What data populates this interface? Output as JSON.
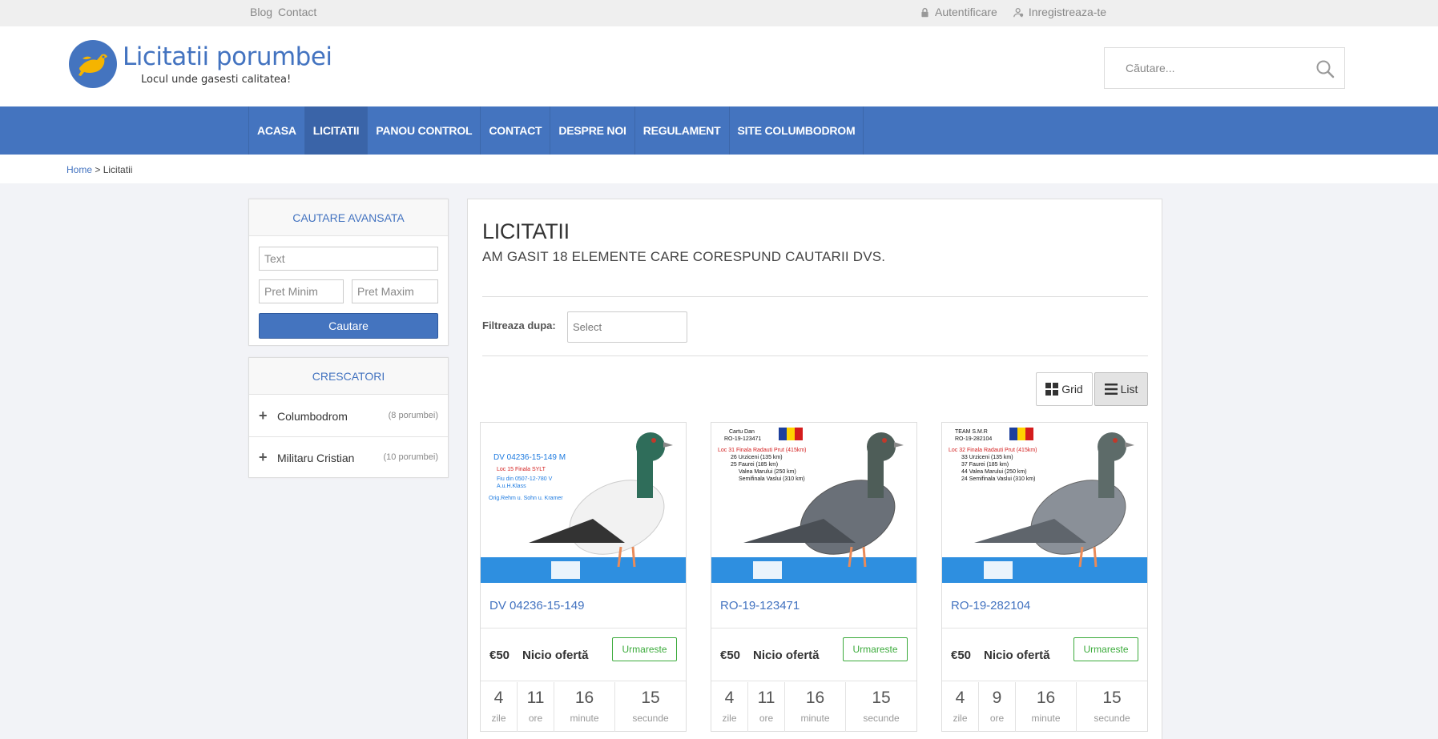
{
  "topbar": {
    "blog": "Blog",
    "contact": "Contact",
    "login": "Autentificare",
    "register": "Inregistreaza-te"
  },
  "header": {
    "brand": "Licitatii porumbei",
    "tagline": "Locul unde gasesti calitatea!",
    "search_placeholder": "Căutare..."
  },
  "nav": [
    "ACASA",
    "LICITATII",
    "PANOU CONTROL",
    "CONTACT",
    "DESPRE NOI",
    "REGULAMENT",
    "SITE COLUMBODROM"
  ],
  "nav_active": "LICITATII",
  "breadcrumb": {
    "home": "Home",
    "sep": ">",
    "current": "Licitatii"
  },
  "advanced_search": {
    "title": "CAUTARE AVANSATA",
    "text_placeholder": "Text",
    "min_placeholder": "Pret Minim",
    "max_placeholder": "Pret Maxim",
    "button": "Cautare"
  },
  "breeders": {
    "title": "CRESCATORI",
    "items": [
      {
        "name": "Columbodrom",
        "count": "(8 porumbei)"
      },
      {
        "name": "Militaru Cristian",
        "count": "(10 porumbei)"
      }
    ]
  },
  "main": {
    "title": "LICITATII",
    "subtitle": "AM GASIT 18 ELEMENTE CARE CORESPUND CAUTARII DVS.",
    "filter_label": "Filtreaza dupa:",
    "filter_select": "Select",
    "view_grid": "Grid",
    "view_list": "List"
  },
  "countdown_units": [
    "zile",
    "ore",
    "minute",
    "secunde"
  ],
  "cards": [
    {
      "title": "DV 04236-15-149",
      "price": "€50",
      "offer": "Nicio ofertă",
      "follow": "Urmareste",
      "countdown": [
        "4",
        "11",
        "16",
        "15"
      ],
      "image_text": {
        "l1": "DV 04236-15-149  M",
        "l2": "Loc 15 Finala SYLT",
        "l3": "Fiu din 0507-12-780 V",
        "l4": "A.u.H.Klass",
        "l5": "Orig.Rehm u. Sohn u. Kramer"
      },
      "pigeon_color": "#f2f2f2"
    },
    {
      "title": "RO-19-123471",
      "price": "€50",
      "offer": "Nicio ofertă",
      "follow": "Urmareste",
      "countdown": [
        "4",
        "11",
        "16",
        "15"
      ],
      "image_text": {
        "l1": "Cartu Dan",
        "l2": "RO-19-123471",
        "l3": "Loc 31 Finala Radauti Prut (415km)",
        "l4": "26 Urziceni (135 km)",
        "l5": "25 Faurei (185 km)",
        "l6": "Valea Marului (250 km)",
        "l7": "Semifinala Vaslui (310 km)"
      },
      "pigeon_color": "#6a7078"
    },
    {
      "title": "RO-19-282104",
      "price": "€50",
      "offer": "Nicio ofertă",
      "follow": "Urmareste",
      "countdown": [
        "4",
        "9",
        "16",
        "15"
      ],
      "image_text": {
        "l1": "TEAM S.M.R",
        "l2": "RO-19-282104",
        "l3": "Loc 32 Finala Radauti Prut (415km)",
        "l4": "33 Urziceni (135 km)",
        "l5": "37 Faurei (185 km)",
        "l6": "44 Valea Marului (250 km)",
        "l7": "24 Semifinala Vaslui (310 km)"
      },
      "pigeon_color": "#8a9098"
    }
  ],
  "colors": {
    "brand": "#4474bf",
    "link": "#4373c0",
    "follow": "#3cab3c"
  }
}
